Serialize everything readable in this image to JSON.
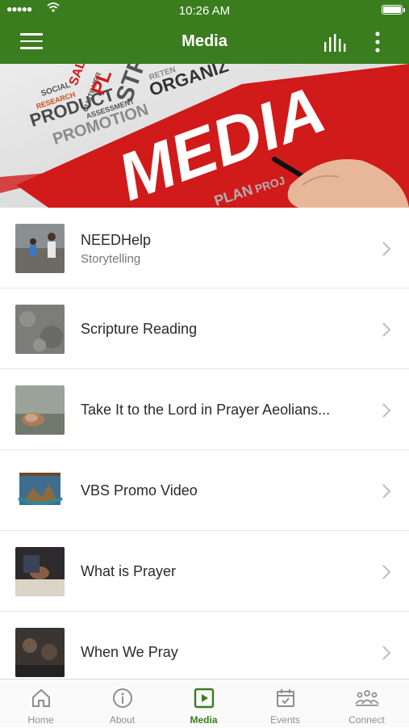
{
  "status_bar": {
    "time": "10:26 AM"
  },
  "header": {
    "title": "Media"
  },
  "banner": {
    "main_word": "MEDIA",
    "words": [
      "PRODUCT",
      "SOCIAL",
      "SALE",
      "PROMOTION",
      "RESEARCH",
      "CUSTOMER",
      "ASSESSMENT",
      "PL",
      "STR",
      "ORGANIZ",
      "RETEN",
      "PLAN",
      "PROJ"
    ]
  },
  "media_items": [
    {
      "title": "NEEDHelp",
      "subtitle": "Storytelling"
    },
    {
      "title": "Scripture Reading"
    },
    {
      "title": "Take It to the Lord in Prayer Aeolians..."
    },
    {
      "title": "VBS Promo Video"
    },
    {
      "title": "What is Prayer"
    },
    {
      "title": "When We Pray"
    }
  ],
  "tabs": [
    {
      "label": "Home",
      "icon": "home-icon"
    },
    {
      "label": "About",
      "icon": "info-icon"
    },
    {
      "label": "Media",
      "icon": "play-icon",
      "active": true
    },
    {
      "label": "Events",
      "icon": "calendar-icon"
    },
    {
      "label": "Connect",
      "icon": "people-icon"
    }
  ],
  "colors": {
    "brand_green": "#3a7d1e",
    "banner_red": "#d11a1a"
  }
}
